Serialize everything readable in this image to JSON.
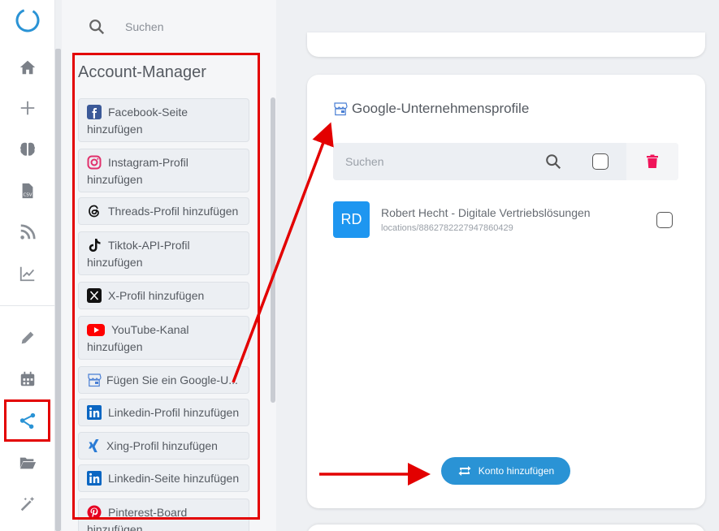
{
  "search": {
    "placeholder": "Suchen"
  },
  "account_manager": {
    "title": "Account-Manager",
    "items": [
      {
        "label": "Facebook-Seite hinzufügen",
        "icon": "facebook-icon"
      },
      {
        "label": "Instagram-Profil hinzufügen",
        "icon": "instagram-icon"
      },
      {
        "label": "Threads-Profil hinzufügen",
        "icon": "threads-icon"
      },
      {
        "label": "Tiktok-API-Profil hinzufügen",
        "icon": "tiktok-icon"
      },
      {
        "label": "X-Profil hinzufügen",
        "icon": "x-icon"
      },
      {
        "label": "YouTube-Kanal hinzufügen",
        "icon": "youtube-icon"
      },
      {
        "label": "Fügen Sie ein Google-U...",
        "icon": "google-business-icon"
      },
      {
        "label": "Linkedin-Profil hinzufügen",
        "icon": "linkedin-icon"
      },
      {
        "label": "Xing-Profil hinzufügen",
        "icon": "xing-icon"
      },
      {
        "label": "Linkedin-Seite hinzufügen",
        "icon": "linkedin-icon"
      },
      {
        "label": "Pinterest-Board hinzufügen",
        "icon": "pinterest-icon"
      }
    ]
  },
  "main": {
    "section_title": "Google-Unternehmensprofile",
    "toolbar": {
      "search_placeholder": "Suchen"
    },
    "profiles": [
      {
        "initials": "RD",
        "name": "Robert Hecht - Digitale Vertriebslösungen",
        "location": "locations/8862782227947860429"
      }
    ],
    "add_button_label": "Konto hinzufügen"
  },
  "colors": {
    "accent": "#2a93d5",
    "avatar": "#1e96f0",
    "annotation": "#e30000",
    "delete": "#f0145a"
  }
}
